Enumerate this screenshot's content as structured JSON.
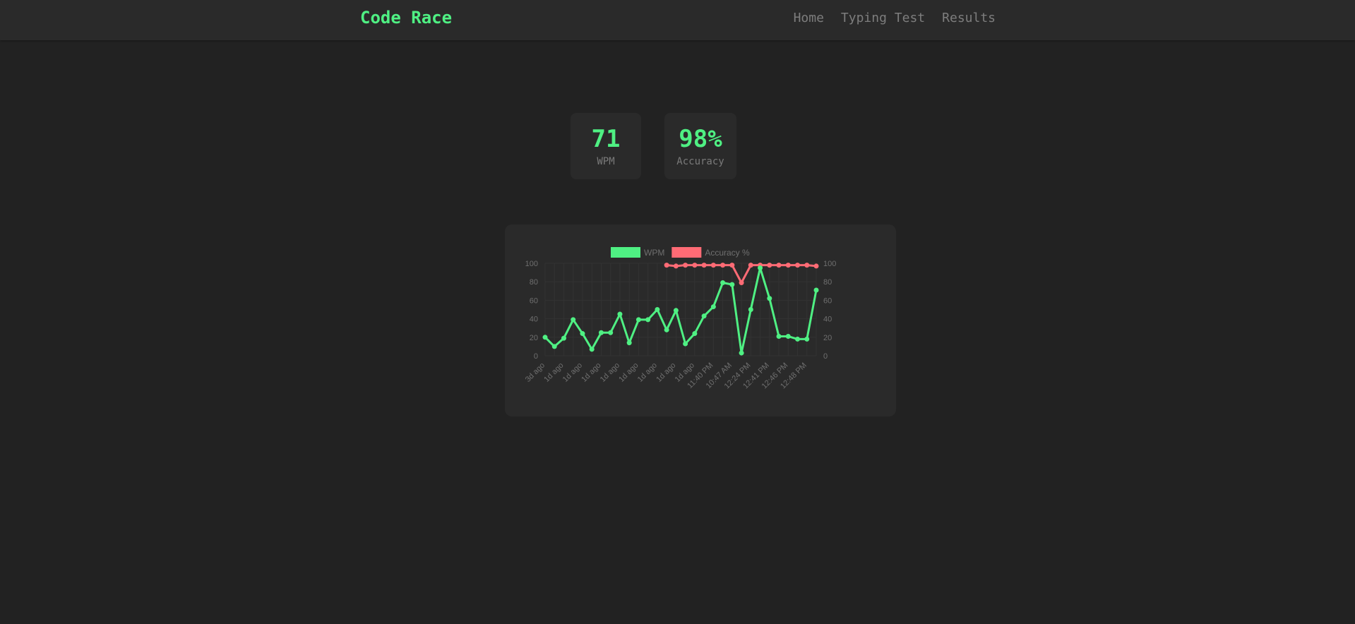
{
  "header": {
    "brand": "Code Race",
    "nav": [
      {
        "label": "Home"
      },
      {
        "label": "Typing Test"
      },
      {
        "label": "Results"
      }
    ]
  },
  "stats": [
    {
      "value": "71",
      "label": "WPM"
    },
    {
      "value": "98%",
      "label": "Accuracy"
    }
  ],
  "colors": {
    "accent": "#4ff083",
    "accuracy": "#ff6b75",
    "background": "#222222",
    "panel": "#2a2a2a"
  },
  "chart_data": {
    "type": "line",
    "title": "",
    "xlabel": "",
    "ylabel": "",
    "ylim": [
      0,
      100
    ],
    "y_ticks": [
      0,
      20,
      40,
      60,
      80,
      100
    ],
    "grid": true,
    "legend_position": "top-center",
    "x_tick_labels": [
      "3d ago",
      "1d ago",
      "1d ago",
      "1d ago",
      "1d ago",
      "1d ago",
      "1d ago",
      "1d ago",
      "1d ago",
      "11:40 PM",
      "10:47 AM",
      "12:24 PM",
      "12:41 PM",
      "12:46 PM",
      "12:48 PM"
    ],
    "x": [
      "3d ago",
      "",
      "1d ago",
      "",
      "1d ago",
      "",
      "1d ago",
      "",
      "1d ago",
      "",
      "1d ago",
      "",
      "1d ago",
      "",
      "1d ago",
      "",
      "1d ago",
      "",
      "11:40 PM",
      "",
      "10:47 AM",
      "",
      "12:24 PM",
      "",
      "12:41 PM",
      "",
      "12:46 PM",
      "",
      "12:48 PM",
      ""
    ],
    "series": [
      {
        "name": "WPM",
        "color": "#4ff083",
        "values": [
          20,
          10,
          19,
          39,
          24,
          7,
          25,
          25,
          45,
          14,
          39,
          39,
          50,
          28,
          49,
          13,
          24,
          43,
          53,
          79,
          77,
          3,
          50,
          95,
          62,
          21,
          21,
          18,
          18,
          71
        ]
      },
      {
        "name": "Accuracy %",
        "color": "#ff6b75",
        "values": [
          null,
          null,
          null,
          null,
          null,
          null,
          null,
          null,
          null,
          null,
          null,
          null,
          null,
          98,
          97,
          98,
          98,
          98,
          98,
          98,
          98,
          79,
          98,
          98,
          98,
          98,
          98,
          98,
          98,
          97
        ]
      }
    ]
  }
}
